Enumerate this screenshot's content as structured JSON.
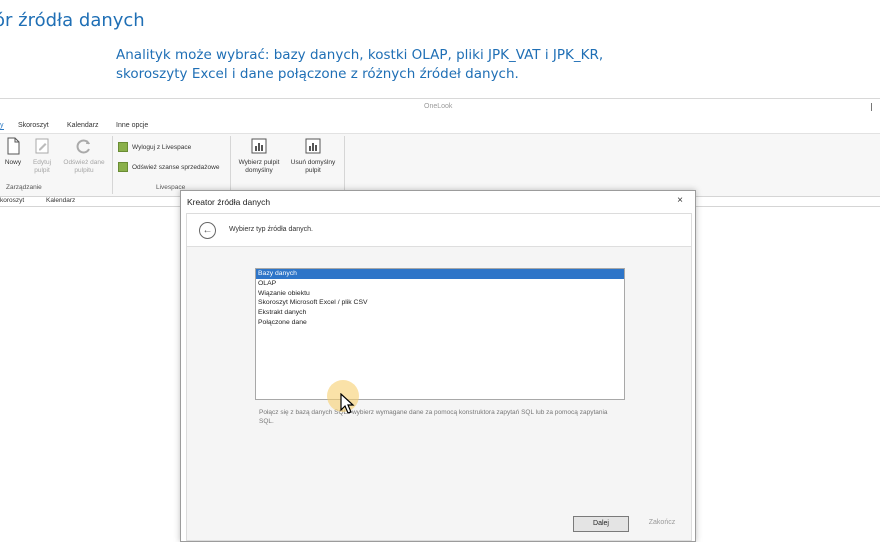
{
  "slide": {
    "title": "ór źródła danych",
    "subtitle_line1": "Analityk może wybrać: bazy danych, kostki OLAP, pliki JPK_VAT i JPK_KR,",
    "subtitle_line2": "skoroszyty Excel i dane połączone z różnych źródeł danych."
  },
  "app": {
    "title": "OneLook",
    "ribbon_tabs": [
      "y",
      "Skoroszyt",
      "Kalendarz",
      "Inne opcje"
    ],
    "groups": {
      "zarzadzanie": {
        "label": "Zarządzanie",
        "buttons": [
          {
            "label": "Nowy"
          },
          {
            "label": "Edytuj pulpit"
          },
          {
            "label": "Odśwież dane pulpitu"
          }
        ]
      },
      "livespace": {
        "label": "Livespace",
        "buttons": [
          {
            "label": "Wyloguj z Livespace"
          },
          {
            "label": "Odśwież szanse sprzedażowe"
          }
        ]
      },
      "pulpit": {
        "buttons": [
          {
            "label": "Wybierz pulpit domyślny"
          },
          {
            "label": "Usuń domyślny pulpit"
          }
        ]
      }
    },
    "doc_tabs": [
      "koroszyt",
      "Kalendarz"
    ]
  },
  "dialog": {
    "title": "Kreator źródła danych",
    "close": "×",
    "step_label": "Wybierz typ źródła danych.",
    "back_symbol": "←",
    "list_items": [
      "Bazy danych",
      "OLAP",
      "Wiązanie obiektu",
      "Skoroszyt Microsoft Excel / plik CSV",
      "Ekstrakt danych",
      "Połączone dane"
    ],
    "selected_index": 0,
    "description": "Połącz się z bazą danych SQL i wybierz wymagane dane za pomocą konstruktora zapytań SQL lub za pomocą zapytania SQL.",
    "next_button": "Dalej",
    "finish_button": "Zakończ"
  },
  "icons": {
    "new": "new-document-icon",
    "edit": "edit-dashboard-icon",
    "refresh": "refresh-icon",
    "logout": "logout-icon",
    "refresh_sales": "refresh-sales-icon",
    "choose_dashboard": "choose-dashboard-icon",
    "remove_dashboard": "remove-dashboard-icon",
    "cursor": "mouse-cursor-icon"
  },
  "colors": {
    "slide_accent": "#1f6fb5",
    "selection": "#2e75c8",
    "highlight": "#f6cf6e"
  }
}
